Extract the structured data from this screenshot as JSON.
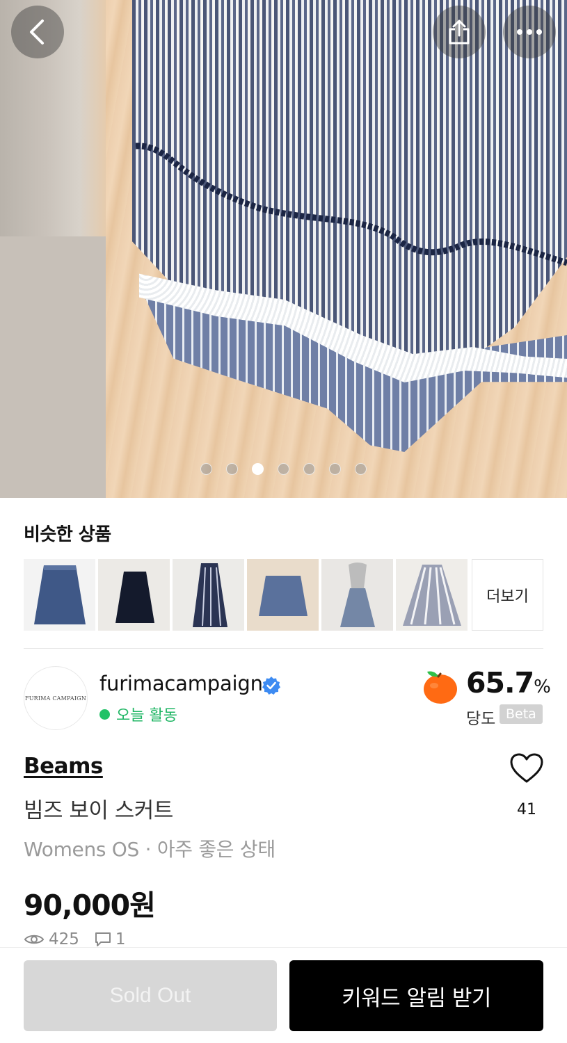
{
  "hero": {
    "image_description": "",
    "carousel": {
      "count": 7,
      "active_index": 2
    },
    "back_icon": "chevron-left-icon",
    "share_icon": "share-icon",
    "more_icon": "more-horizontal-icon"
  },
  "similar": {
    "title": "비슷한 상품",
    "more_label": "더보기",
    "items": [
      {
        "icon": "skirt-thumbnail"
      },
      {
        "icon": "skirt-thumbnail"
      },
      {
        "icon": "skirt-thumbnail"
      },
      {
        "icon": "skirt-thumbnail"
      },
      {
        "icon": "skirt-thumbnail"
      },
      {
        "icon": "skirt-thumbnail"
      }
    ]
  },
  "seller": {
    "avatar_text": "FURIMA CAMPAIGN",
    "name": "furimacampaign",
    "verified": true,
    "activity": "오늘 활동",
    "activity_color": "#1fb664",
    "temperature": {
      "value": "65.7",
      "unit": "%",
      "label": "당도",
      "badge": "Beta"
    }
  },
  "item": {
    "brand": "Beams",
    "title": "빔즈 보이 스커트",
    "meta": "Womens OS · 아주 좋은 상태",
    "price": "90,000원",
    "views": "425",
    "comments": "1",
    "likes": "41"
  },
  "actions": {
    "sold_out": "Sold Out",
    "keyword_alert": "키워드 알림 받기"
  },
  "colors": {
    "accent_black": "#000000",
    "active_green": "#22c267",
    "verified_blue": "#3d8bf2",
    "fruit_orange": "#ff6a13"
  }
}
